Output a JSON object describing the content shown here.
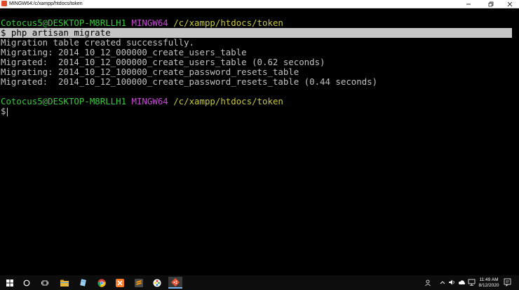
{
  "window": {
    "title": "MINGW64:/c/xampp/htdocs/token",
    "icon": "mingw-icon"
  },
  "terminal": {
    "prompt1": {
      "user": "Cotocus5@DESKTOP-M8RLLH1",
      "sys": "MINGW64",
      "path": "/c/xampp/htdocs/token"
    },
    "command": "$ php artisan migrate",
    "output": [
      "Migration table created successfully.",
      "Migrating: 2014_10_12_000000_create_users_table",
      "Migrated:  2014_10_12_000000_create_users_table (0.62 seconds)",
      "Migrating: 2014_10_12_100000_create_password_resets_table",
      "Migrated:  2014_10_12_100000_create_password_resets_table (0.44 seconds)"
    ],
    "prompt2": {
      "user": "Cotocus5@DESKTOP-M8RLLH1",
      "sys": "MINGW64",
      "path": "/c/xampp/htdocs/token"
    },
    "input_prompt": "$"
  },
  "taskbar": {
    "items": [
      "windows-start-icon",
      "search-circle-icon",
      "task-view-icon",
      "file-explorer-icon",
      "notepad-icon",
      "chrome-icon",
      "xampp-icon",
      "sublime-text-icon",
      "color-picker-icon",
      "git-bash-icon"
    ],
    "clock": {
      "time": "11:49 AM",
      "date": "8/12/2020"
    }
  },
  "colors": {
    "user": "#39c83f",
    "sys": "#c34ad2",
    "path": "#c8c83c",
    "highlight": "#c6c6c6"
  }
}
